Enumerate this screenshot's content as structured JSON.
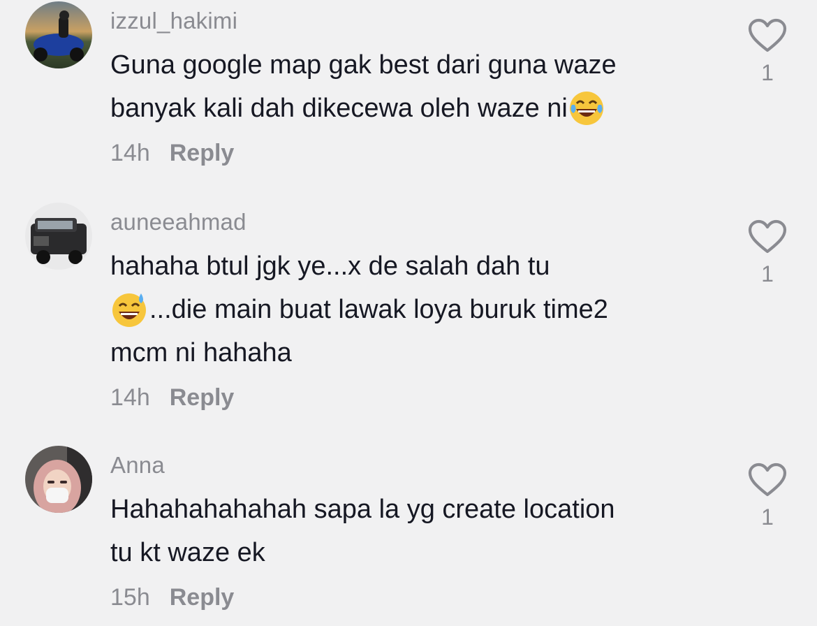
{
  "comments": [
    {
      "username": "izzul_hakimi",
      "lines": [
        "Guna google map gak best dari guna waze",
        "banyak kali dah dikecewa oleh waze ni"
      ],
      "emoji": "tears-of-joy-emoji",
      "time": "14h",
      "reply_label": "Reply",
      "likes": "1"
    },
    {
      "username": "auneeahmad",
      "lines": [
        "hahaha btul jgk ye...x de salah dah tu",
        "...die main buat lawak loya buruk time2",
        "mcm ni hahaha"
      ],
      "emoji": "grinning-sweat-emoji",
      "time": "14h",
      "reply_label": "Reply",
      "likes": "1"
    },
    {
      "username": "Anna",
      "lines": [
        "Hahahahahahah sapa la yg create location",
        "tu kt waze ek"
      ],
      "time": "15h",
      "reply_label": "Reply",
      "likes": "1"
    }
  ],
  "colors": {
    "background": "#f1f1f2",
    "text": "#161823",
    "muted": "#8a8b91"
  }
}
